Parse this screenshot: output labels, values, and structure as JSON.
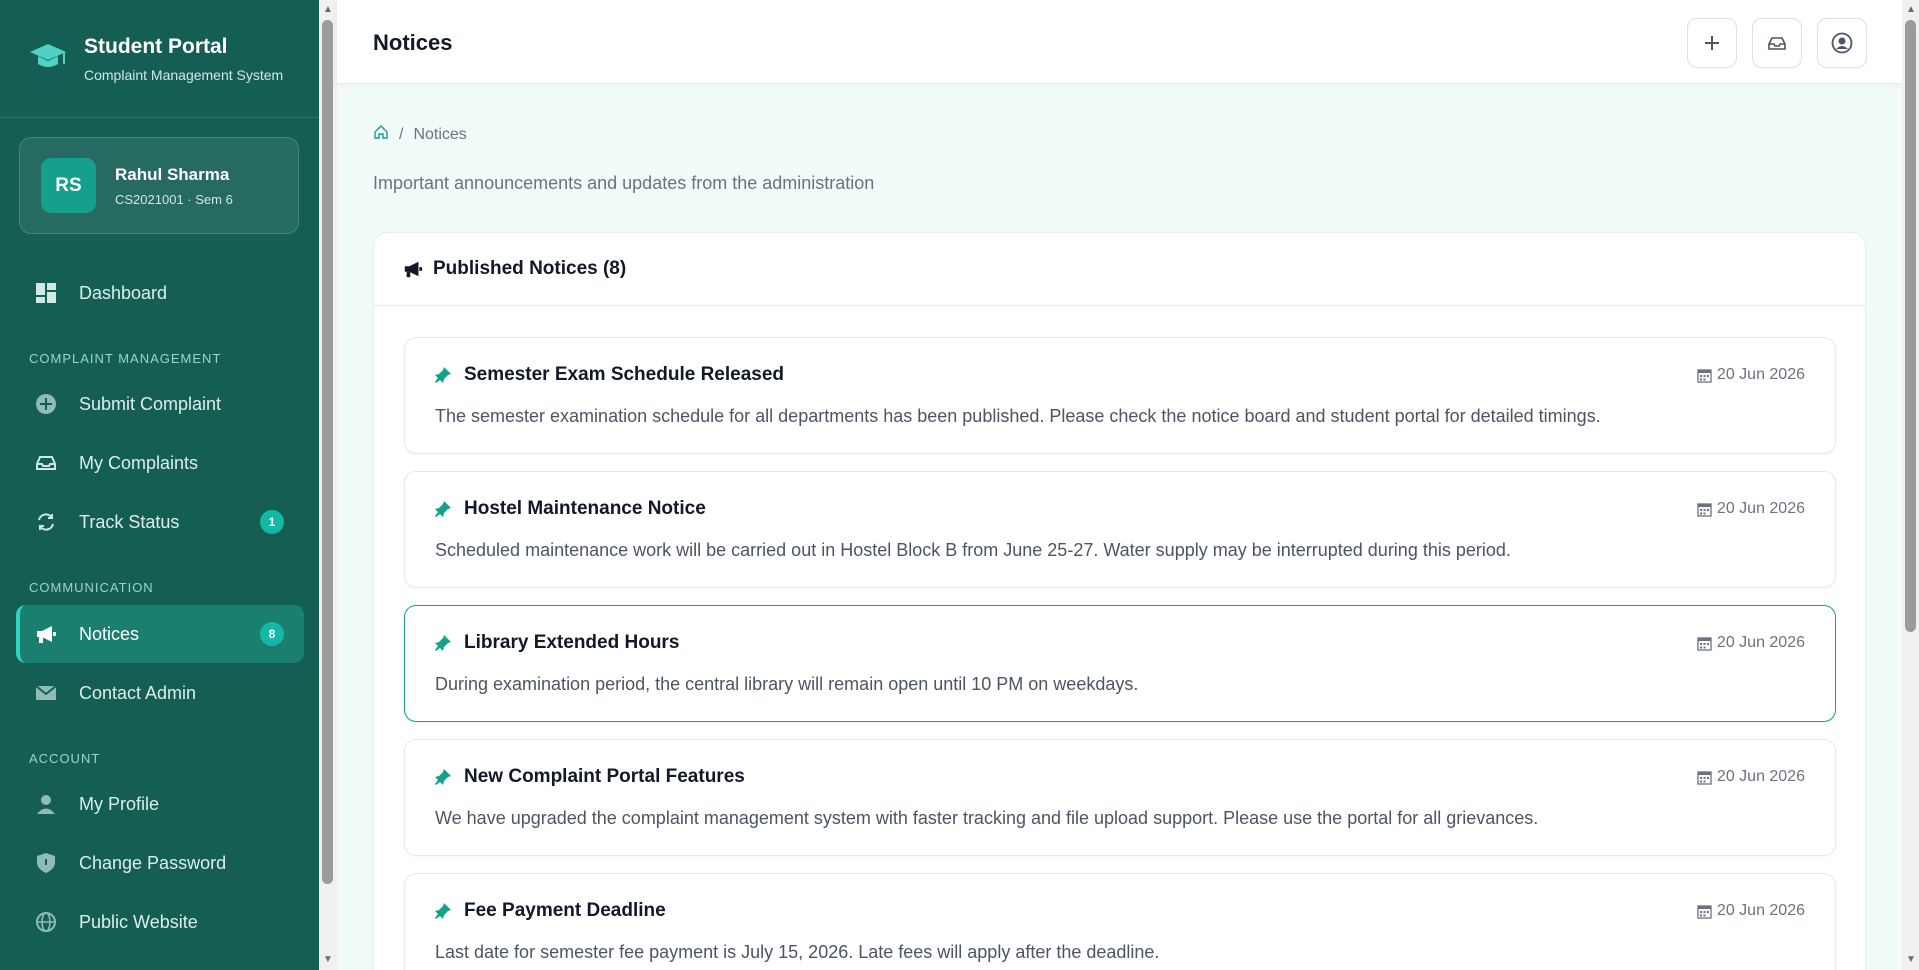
{
  "brand": {
    "title": "Student Portal",
    "subtitle": "Complaint Management System"
  },
  "user": {
    "initials": "RS",
    "name": "Rahul Sharma",
    "meta": "CS2021001 · Sem 6"
  },
  "sidebar": {
    "dashboard": "Dashboard",
    "section_complaints": "COMPLAINT MANAGEMENT",
    "submit": "Submit Complaint",
    "my_complaints": "My Complaints",
    "track": "Track Status",
    "track_badge": "1",
    "section_comm": "COMMUNICATION",
    "notices": "Notices",
    "notices_badge": "8",
    "contact": "Contact Admin",
    "section_account": "ACCOUNT",
    "profile": "My Profile",
    "password": "Change Password",
    "website": "Public Website"
  },
  "header": {
    "title": "Notices"
  },
  "breadcrumb": {
    "current": "Notices"
  },
  "page": {
    "subtitle": "Important announcements and updates from the administration"
  },
  "panel": {
    "title": "Published Notices (8)"
  },
  "notices": [
    {
      "title": "Semester Exam Schedule Released",
      "date": "20 Jun 2026",
      "body": "The semester examination schedule for all departments has been published. Please check the notice board and student portal for detailed timings."
    },
    {
      "title": "Hostel Maintenance Notice",
      "date": "20 Jun 2026",
      "body": "Scheduled maintenance work will be carried out in Hostel Block B from June 25-27. Water supply may be interrupted during this period."
    },
    {
      "title": "Library Extended Hours",
      "date": "20 Jun 2026",
      "body": "During examination period, the central library will remain open until 10 PM on weekdays."
    },
    {
      "title": "New Complaint Portal Features",
      "date": "20 Jun 2026",
      "body": "We have upgraded the complaint management system with faster tracking and file upload support. Please use the portal for all grievances."
    },
    {
      "title": "Fee Payment Deadline",
      "date": "20 Jun 2026",
      "body": "Last date for semester fee payment is July 15, 2026. Late fees will apply after the deadline."
    }
  ]
}
